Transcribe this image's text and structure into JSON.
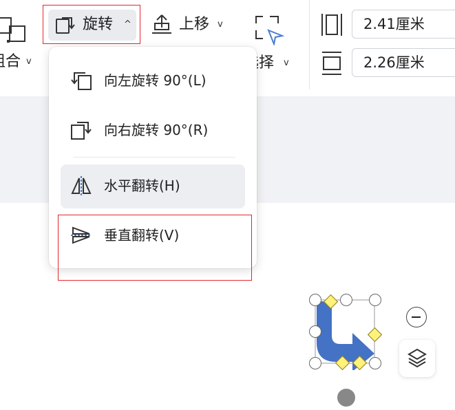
{
  "ribbon": {
    "group_label": "组合",
    "rotate_label": "旋转",
    "rotate_chevron": "^",
    "move_up_label": "上移",
    "move_up_chevron": "v",
    "select_label": "选择",
    "width_value": "2.41厘米",
    "height_value": "2.26厘米",
    "dropdown_chevron": "v"
  },
  "rotate_menu": {
    "items": [
      {
        "label": "向左旋转 90°(L)",
        "icon": "rotate-left-icon"
      },
      {
        "label": "向右旋转 90°(R)",
        "icon": "rotate-right-icon"
      },
      {
        "label": "水平翻转(H)",
        "icon": "flip-horizontal-icon"
      },
      {
        "label": "垂直翻转(V)",
        "icon": "flip-vertical-icon"
      }
    ]
  },
  "colors": {
    "accent": "#4472c4",
    "highlight_border": "#e3262e",
    "shape_handle_fill": "#fff27a"
  }
}
